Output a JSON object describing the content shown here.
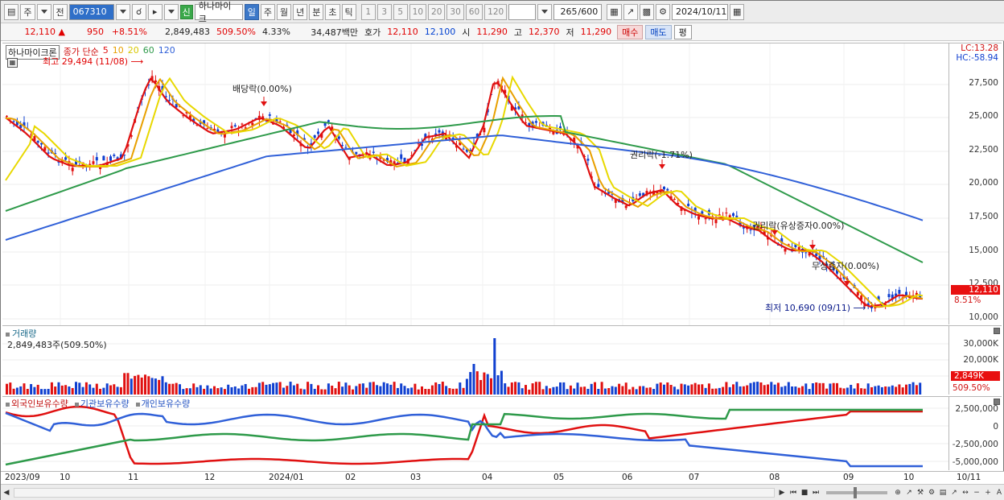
{
  "toolbar": {
    "period_btn": "주",
    "prev_btn": "전",
    "code": "067310",
    "sin_badge": "신",
    "stock_name": "하나마이크",
    "periods": [
      "일",
      "주",
      "월",
      "년",
      "분",
      "초",
      "틱"
    ],
    "active_period": "일",
    "nums": [
      "1",
      "3",
      "5",
      "10",
      "20",
      "30",
      "60",
      "120"
    ],
    "count": "265",
    "count_total": "/600",
    "date": "2024/10/11"
  },
  "quote": {
    "price": "12,110",
    "change": "950",
    "change_pct": "+8.51%",
    "volume": "2,849,483",
    "vol_ratio": "509.50%",
    "turnover": "4.33%",
    "amount": "34,487백만",
    "hoga_label": "호가",
    "ask": "12,110",
    "bid": "12,100",
    "open_label": "시",
    "open": "11,290",
    "high_label": "고",
    "high": "12,370",
    "low_label": "저",
    "low": "11,290",
    "buy": "매수",
    "sell": "매도",
    "eval": "평"
  },
  "price_panel": {
    "name": "하나마이크론",
    "legend_prefix": "종가 단순",
    "ma": [
      {
        "period": "5",
        "color": "#e01010"
      },
      {
        "period": "10",
        "color": "#e8a000"
      },
      {
        "period": "20",
        "color": "#e8d800"
      },
      {
        "period": "60",
        "color": "#2e9a4a"
      },
      {
        "period": "120",
        "color": "#3060d8"
      }
    ],
    "high_note": "최고 29,494 (11/08)",
    "low_note": "최저 10,690 (09/11)",
    "events": [
      {
        "label": "배당락(0.00%)"
      },
      {
        "label": "권리락(-1.71%)"
      },
      {
        "label": "권리락(유상증자0.00%)"
      },
      {
        "label": "무상증자(0.00%)"
      }
    ],
    "lc": "LC:13.28",
    "hc": "HC:-58.94",
    "y_ticks": [
      "27,500",
      "25,000",
      "22,500",
      "20,000",
      "17,500",
      "15,000",
      "12,500",
      "10,000"
    ],
    "last_price": "12,110",
    "last_pct": "8.51%"
  },
  "volume_panel": {
    "title": "거래량",
    "info": "2,849,483주(509.50%)",
    "y_ticks": [
      "30,000K",
      "20,000K",
      "10,000K"
    ],
    "last": "2,849K",
    "last_pct": "509.50%"
  },
  "investor_panel": {
    "legend": [
      {
        "label": "외국인보유수량",
        "color": "#e01010"
      },
      {
        "label": "기관보유수량",
        "color": "#3060d8"
      },
      {
        "label": "개인보유수량",
        "color": "#2e9a4a"
      }
    ],
    "y_ticks": [
      "2,500,000",
      "0",
      "-2,500,000",
      "-5,000,000"
    ]
  },
  "x_axis": [
    "2023/09",
    "10",
    "11",
    "12",
    "2024/01",
    "02",
    "03",
    "04",
    "05",
    "06",
    "07",
    "08",
    "09",
    "10",
    "10/11"
  ],
  "colors": {
    "up": "#e01010",
    "down": "#1040d0"
  }
}
